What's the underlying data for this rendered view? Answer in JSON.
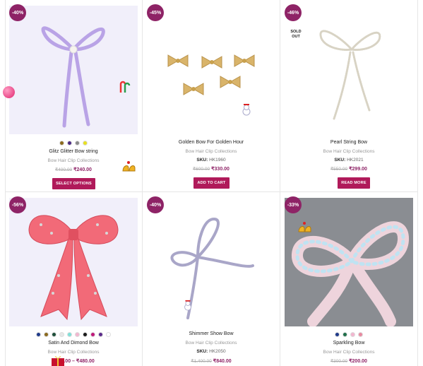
{
  "products": [
    {
      "badge": "-40%",
      "swatches": [
        "#8b6a1e",
        "#4b2a83",
        "#8a8a8a",
        "#e8e020"
      ],
      "title": "Glitz Glitter Bow string",
      "category": "Bow Hair Clip Collections",
      "old_price": "₹400.00",
      "new_price": "₹240.00",
      "button": "SELECT OPTIONS"
    },
    {
      "badge": "-45%",
      "title": "Golden Bow For Golden Hour",
      "category": "Bow Hair Clip Collections",
      "sku_label": "SKU:",
      "sku_value": "HK1960",
      "old_price": "₹600.00",
      "new_price": "₹330.00",
      "button": "ADD TO CART"
    },
    {
      "badge": "-46%",
      "sold_out": "SOLD OUT",
      "title": "Pearl String Bow",
      "category": "Bow Hair Clip Collections",
      "sku_label": "SKU:",
      "sku_value": "HK2021",
      "old_price": "₹550.00",
      "new_price": "₹299.00",
      "button": "READ MORE"
    },
    {
      "badge": "-56%",
      "swatches": [
        "#1f3a8a",
        "#8b6a1e",
        "#1f4f3a",
        "#e8e8e8",
        "#7fe0d8",
        "#f2b6cf",
        "#1a1a1a",
        "#c0187a",
        "#5a2a8a",
        "#ffffff"
      ],
      "title": "Satin And Dimond Bow",
      "category": "Bow Hair Clip Collections",
      "price_range": "₹200.00 – ₹480.00"
    },
    {
      "badge": "-40%",
      "title": "Shimmer Show Bow",
      "category": "Bow Hair Clip Collections",
      "sku_label": "SKU:",
      "sku_value": "HK2050",
      "old_price": "₹1,400.00",
      "new_price": "₹840.00"
    },
    {
      "badge": "-33%",
      "swatches": [
        "#1f3a8a",
        "#1f6f4a",
        "#f2b6cf",
        "#e88aa0"
      ],
      "title": "Sparkling Bow",
      "category": "Bow Hair Clip Collections",
      "old_price": "₹300.00",
      "new_price": "₹200.00"
    }
  ],
  "colors": {
    "accent": "#8e2366",
    "button": "#b01a5a"
  }
}
